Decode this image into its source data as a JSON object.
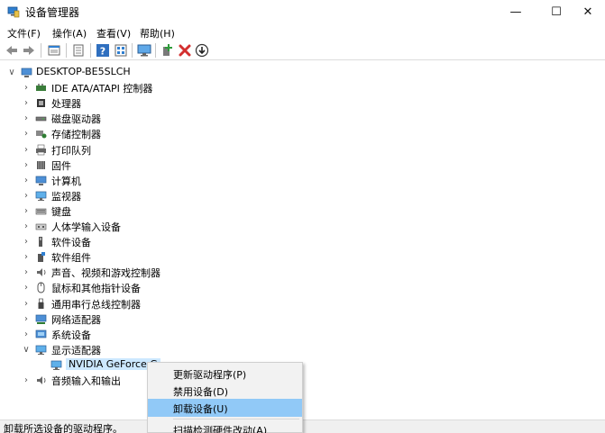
{
  "window": {
    "title": "设备管理器",
    "min_glyph": "—",
    "max_glyph": "☐",
    "close_glyph": "✕"
  },
  "menu": {
    "items": [
      {
        "label": "文件(F)"
      },
      {
        "label": "操作(A)"
      },
      {
        "label": "查看(V)"
      },
      {
        "label": "帮助(H)"
      }
    ]
  },
  "toolbar": {
    "icons": [
      "back-arrow-icon",
      "forward-arrow-icon",
      "properties-grid-icon",
      "properties-sheet-icon",
      "help-icon",
      "device-list-icon",
      "monitor-icon",
      "add-driver-icon",
      "remove-x-icon",
      "download-circle-icon"
    ]
  },
  "tree": {
    "root": {
      "label": "DESKTOP-BE5SLCH",
      "expanded": true
    },
    "items": [
      {
        "label": "IDE ATA/ATAPI 控制器",
        "icon": "ide-controller-icon",
        "expanded": false
      },
      {
        "label": "处理器",
        "icon": "processor-icon",
        "expanded": false
      },
      {
        "label": "磁盘驱动器",
        "icon": "disk-drive-icon",
        "expanded": false
      },
      {
        "label": "存储控制器",
        "icon": "storage-controller-icon",
        "expanded": false
      },
      {
        "label": "打印队列",
        "icon": "printer-icon",
        "expanded": false
      },
      {
        "label": "固件",
        "icon": "firmware-icon",
        "expanded": false
      },
      {
        "label": "计算机",
        "icon": "computer-icon",
        "expanded": false
      },
      {
        "label": "监视器",
        "icon": "monitor-icon",
        "expanded": false
      },
      {
        "label": "键盘",
        "icon": "keyboard-icon",
        "expanded": false
      },
      {
        "label": "人体学输入设备",
        "icon": "hid-icon",
        "expanded": false
      },
      {
        "label": "软件设备",
        "icon": "software-device-icon",
        "expanded": false
      },
      {
        "label": "软件组件",
        "icon": "software-component-icon",
        "expanded": false
      },
      {
        "label": "声音、视频和游戏控制器",
        "icon": "sound-icon",
        "expanded": false
      },
      {
        "label": "鼠标和其他指针设备",
        "icon": "mouse-icon",
        "expanded": false
      },
      {
        "label": "通用串行总线控制器",
        "icon": "usb-icon",
        "expanded": false
      },
      {
        "label": "网络适配器",
        "icon": "network-adapter-icon",
        "expanded": false
      },
      {
        "label": "系统设备",
        "icon": "system-device-icon",
        "expanded": false
      },
      {
        "label": "显示适配器",
        "icon": "display-adapter-icon",
        "expanded": true
      },
      {
        "label": "NVIDIA GeForce G",
        "icon": "gpu-icon",
        "child": true
      },
      {
        "label": "音频输入和输出",
        "icon": "audio-io-icon",
        "expanded": false
      }
    ]
  },
  "context_menu": {
    "items": [
      {
        "label": "更新驱动程序(P)"
      },
      {
        "label": "禁用设备(D)"
      },
      {
        "label": "卸载设备(U)",
        "hover": true
      },
      {
        "label": "扫描检测硬件改动(A)"
      }
    ]
  },
  "status": {
    "text": "卸载所选设备的驱动程序。"
  },
  "colors": {
    "hover": "#91c9f7",
    "selection": "#cce8ff",
    "remove_red": "#d32f2f",
    "add_green": "#2e9b3a",
    "icon_blue": "#2f7fd1"
  }
}
